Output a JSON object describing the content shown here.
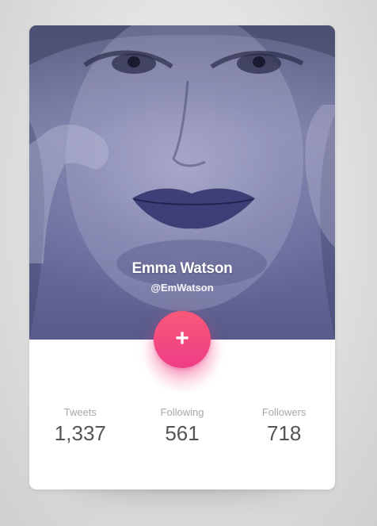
{
  "profile": {
    "name": "Emma Watson",
    "handle": "@EmWatson",
    "photo": "portrait-photo"
  },
  "actions": {
    "add_icon": "+"
  },
  "stats": [
    {
      "label": "Tweets",
      "value": "1,337"
    },
    {
      "label": "Following",
      "value": "561"
    },
    {
      "label": "Followers",
      "value": "718"
    }
  ],
  "colors": {
    "accent_start": "#f8597a",
    "accent_end": "#ee3d86",
    "photo_tint": "#6a6c9c",
    "label": "#a8a8a8",
    "value": "#555555"
  }
}
